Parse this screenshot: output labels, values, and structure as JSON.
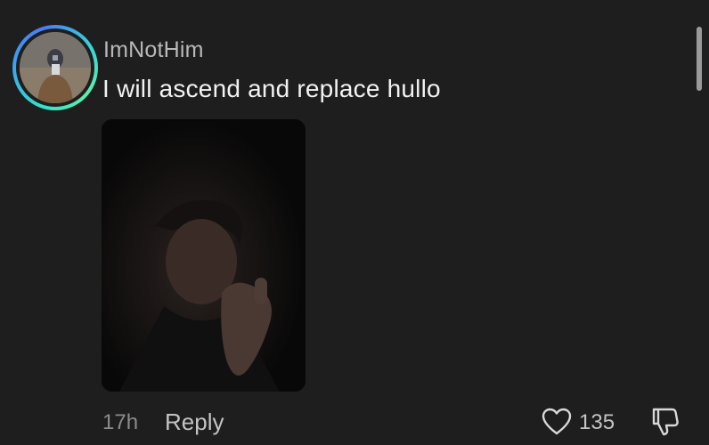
{
  "comment": {
    "username": "ImNotHim",
    "text": "I will ascend and replace hullo",
    "timestamp": "17h",
    "reply_label": "Reply",
    "like_count": "135"
  },
  "icons": {
    "like": "heart-outline-icon",
    "dislike": "thumbs-down-outline-icon"
  },
  "colors": {
    "background": "#1e1e1e",
    "avatar_ring_start": "#37e0c8",
    "avatar_ring_end": "#4a7cf5",
    "username": "#b8b8b8",
    "text": "#f2f2f2",
    "muted": "#8c8c8c"
  }
}
